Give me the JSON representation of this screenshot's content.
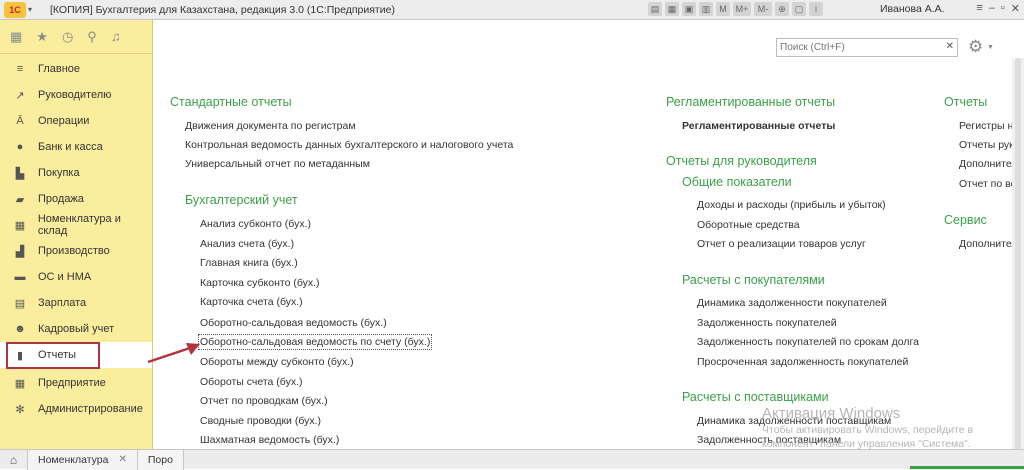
{
  "titlebar": {
    "logo": "1С",
    "title": "[КОПИЯ] Бухгалтерия для Казахстана, редакция 3.0  (1С:Предприятие)",
    "tools": [
      "M",
      "M+",
      "M-"
    ],
    "user": "Иванова А.А."
  },
  "sidebar": {
    "items": [
      {
        "label": "Главное",
        "icon": "menu-icon"
      },
      {
        "label": "Руководителю",
        "icon": "chart-line-icon"
      },
      {
        "label": "Операции",
        "icon": "operations-icon"
      },
      {
        "label": "Банк и касса",
        "icon": "coin-icon"
      },
      {
        "label": "Покупка",
        "icon": "cart-icon"
      },
      {
        "label": "Продажа",
        "icon": "sale-icon"
      },
      {
        "label": "Номенклатура и склад",
        "icon": "warehouse-icon"
      },
      {
        "label": "Производство",
        "icon": "factory-icon"
      },
      {
        "label": "ОС и НМА",
        "icon": "assets-icon"
      },
      {
        "label": "Зарплата",
        "icon": "salary-icon"
      },
      {
        "label": "Кадровый учет",
        "icon": "personnel-icon"
      },
      {
        "label": "Отчеты",
        "icon": "bar-chart-icon"
      },
      {
        "label": "Предприятие",
        "icon": "enterprise-icon"
      },
      {
        "label": "Администрирование",
        "icon": "gear-icon"
      }
    ]
  },
  "search": {
    "placeholder": "Поиск (Ctrl+F)"
  },
  "sections": {
    "standard": {
      "title": "Стандартные отчеты",
      "links": [
        "Движения документа по регистрам",
        "Контрольная ведомость данных бухгалтерского и налогового учета",
        "Универсальный отчет по метаданным"
      ]
    },
    "accounting": {
      "title": "Бухгалтерский учет",
      "links": [
        "Анализ субконто (бух.)",
        "Анализ счета (бух.)",
        "Главная книга (бух.)",
        "Карточка субконто (бух.)",
        "Карточка счета (бух.)",
        "Оборотно-сальдовая ведомость (бух.)",
        "Оборотно-сальдовая ведомость по счету (бух.)",
        "Обороты между субконто (бух.)",
        "Обороты счета (бух.)",
        "Отчет по проводкам (бух.)",
        "Сводные проводки (бух.)",
        "Шахматная ведомость (бух.)"
      ]
    },
    "regulated": {
      "title": "Регламентированные отчеты",
      "links": [
        "Регламентированные отчеты"
      ]
    },
    "management": {
      "title": "Отчеты для руководителя",
      "general": {
        "title": "Общие показатели",
        "links": [
          "Доходы и расходы (прибыль и убыток)",
          "Оборотные средства",
          "Отчет о реализации товаров услуг"
        ]
      },
      "customers": {
        "title": "Расчеты с покупателями",
        "links": [
          "Динамика задолженности покупателей",
          "Задолженность покупателей",
          "Задолженность покупателей по срокам долга",
          "Просроченная задолженность покупателей"
        ]
      },
      "suppliers": {
        "title": "Расчеты с поставщиками",
        "links": [
          "Динамика задолженности поставщикам",
          "Задолженность поставщикам"
        ]
      }
    },
    "reports": {
      "title": "Отчеты",
      "links": [
        "Регистры на",
        "Отчеты руко",
        "Дополнител",
        "Отчет по во"
      ]
    },
    "service": {
      "title": "Сервис",
      "links": [
        "Дополнител"
      ]
    }
  },
  "watermark": {
    "line1": "Активация Windows",
    "line2": "Чтобы активировать Windows, перейдите в",
    "line3": "компонент \"панели управления \"Система\"."
  },
  "tabs": [
    "Номенклатура",
    "Поро"
  ],
  "colors": {
    "sidebar": "#fbed9e",
    "heading": "#3ca04a",
    "highlight": "#b0333f"
  }
}
